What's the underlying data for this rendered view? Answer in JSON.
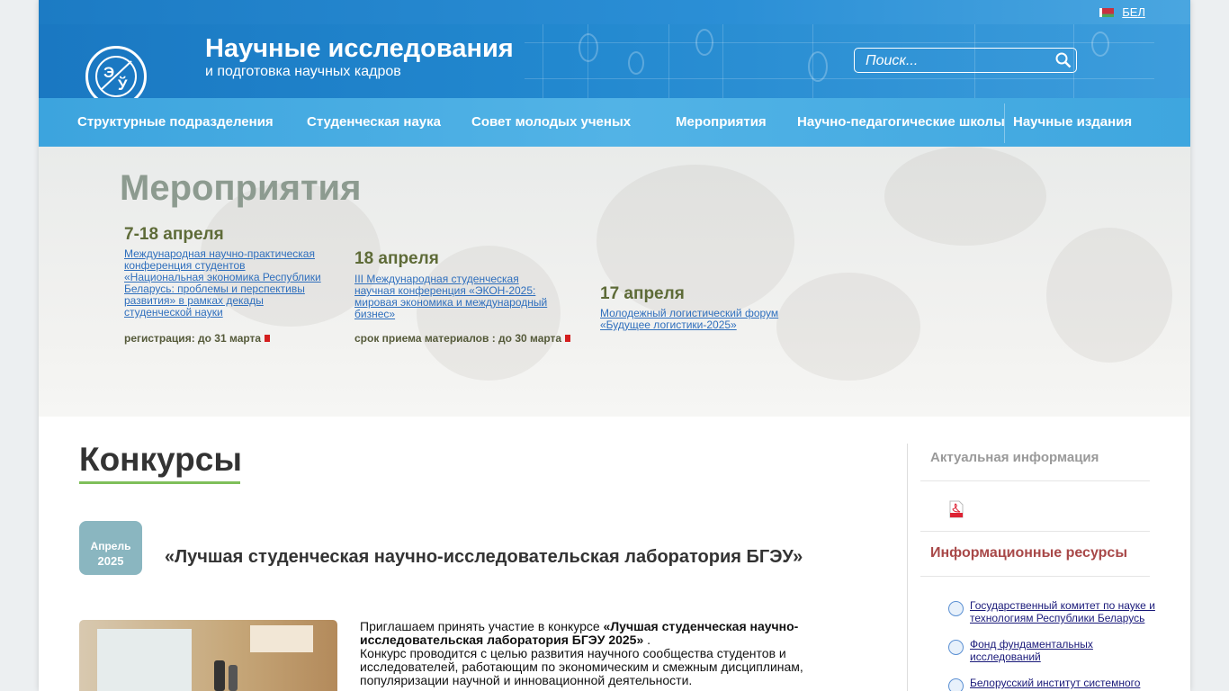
{
  "header": {
    "title": "Научные исследования",
    "subtitle": "и подготовка научных кадров",
    "lang": "БЕЛ",
    "search_placeholder": "Поиск..."
  },
  "nav": {
    "items": [
      "Структурные подразделения",
      "Студенческая наука",
      "Совет молодых ученых",
      "Мероприятия",
      "Научно-педагогические школы",
      "Научные издания"
    ]
  },
  "events": {
    "title": "Мероприятия",
    "list": [
      {
        "date": "7-18 апреля",
        "link": "Международная научно-практическая конференция студентов «Национальная экономика Республики Беларусь: проблемы и перспективы развития» в рамках декады студенческой науки",
        "note": "регистрация: до 31 марта"
      },
      {
        "date": "18 апреля",
        "link": "III Международная студенческая научная конференция «ЭКОН-2025: мировая экономика и международный бизнес»",
        "note": "срок приема материалов : до 30 марта"
      },
      {
        "date": "17 апреля",
        "link": "Молодежный логистический форум «Будущее логистики-2025»",
        "note": ""
      }
    ]
  },
  "main": {
    "title": "Конкурсы",
    "news": {
      "month": "Апрель",
      "year": "2025",
      "title": "«Лучшая студенческая научно-исследовательская лаборатория БГЭУ»",
      "text_intro": "Приглашаем принять участие в конкурсе ",
      "text_bold": "«Лучшая студенческая научно-исследовательская лаборатория БГЭУ 2025»",
      "text_end": " .",
      "text_rest": "Конкурс проводится с целью развития научного сообщества студентов и исследователей, работающим по экономическим и смежным дисциплинам, популяризации научной и инновационной деятельности."
    }
  },
  "sidebar": {
    "actual_title": "Актуальная информация",
    "resources_title": "Информационные ресурсы",
    "resources": [
      "Государственный комитет по науке и технологиям Республики Беларусь",
      "Фонд фундаментальных исследований",
      "Белорусский институт системного"
    ]
  }
}
